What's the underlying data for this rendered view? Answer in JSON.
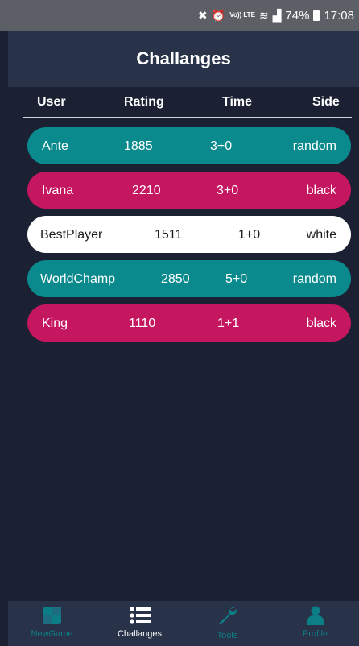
{
  "status_bar": {
    "lte_label": "Vo)) LTE",
    "battery": "74%",
    "time": "17:08"
  },
  "header": {
    "title": "Challanges"
  },
  "table": {
    "columns": [
      "User",
      "Rating",
      "Time",
      "Side"
    ],
    "rows": [
      {
        "user": "Ante",
        "rating": "1885",
        "time": "3+0",
        "side": "random",
        "color": "#0b8a8e"
      },
      {
        "user": "Ivana",
        "rating": "2210",
        "time": "3+0",
        "side": "black",
        "color": "#c51660"
      },
      {
        "user": "BestPlayer",
        "rating": "1511",
        "time": "1+0",
        "side": "white",
        "color": "#ffffff"
      },
      {
        "user": "WorldChamp",
        "rating": "2850",
        "time": "5+0",
        "side": "random",
        "color": "#0b8a8e"
      },
      {
        "user": "King",
        "rating": "1110",
        "time": "1+1",
        "side": "black",
        "color": "#c51660"
      }
    ]
  },
  "bottom_nav": {
    "items": [
      {
        "label": "NewGame",
        "icon": "board-icon",
        "active": false
      },
      {
        "label": "Challanges",
        "icon": "list-icon",
        "active": true
      },
      {
        "label": "Tools",
        "icon": "wrench-icon",
        "active": false
      },
      {
        "label": "Profile",
        "icon": "person-icon",
        "active": false
      }
    ]
  },
  "colors": {
    "background": "#1b2033",
    "header": "#283248",
    "teal": "#0b8a8e",
    "pink": "#c51660",
    "nav_inactive": "#0d7e86"
  }
}
